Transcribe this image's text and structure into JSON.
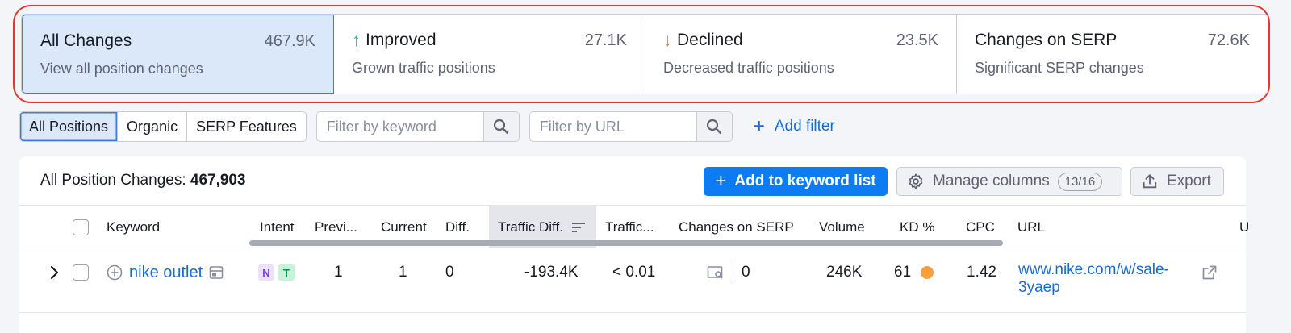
{
  "cards": [
    {
      "title": "All Changes",
      "count": "467.9K",
      "subtitle": "View all position changes",
      "arrow": ""
    },
    {
      "title": "Improved",
      "count": "27.1K",
      "subtitle": "Grown traffic positions",
      "arrow": "↑"
    },
    {
      "title": "Declined",
      "count": "23.5K",
      "subtitle": "Decreased traffic positions",
      "arrow": "↓"
    },
    {
      "title": "Changes on SERP",
      "count": "72.6K",
      "subtitle": "Significant SERP changes",
      "arrow": ""
    }
  ],
  "filters": {
    "segments": [
      "All Positions",
      "Organic",
      "SERP Features"
    ],
    "keyword_placeholder": "Filter by keyword",
    "url_placeholder": "Filter by URL",
    "add_filter": "Add filter"
  },
  "table": {
    "summary_label": "All Position Changes:",
    "summary_count": "467,903",
    "add_to_list": "Add to keyword list",
    "manage_columns": "Manage columns",
    "columns_count": "13/16",
    "export": "Export",
    "columns": [
      "Keyword",
      "Intent",
      "Previ...",
      "Current",
      "Diff.",
      "Traffic Diff.",
      "Traffic...",
      "Changes on SERP",
      "Volume",
      "KD %",
      "CPC",
      "URL",
      "U"
    ],
    "rows": [
      {
        "keyword": "nike outlet",
        "intent": [
          "N",
          "T"
        ],
        "previous": "1",
        "current": "1",
        "diff": "0",
        "traffic_diff": "-193.4K",
        "traffic": "< 0.01",
        "changes_on_serp": "0",
        "volume": "246K",
        "kd": "61",
        "cpc": "1.42",
        "url_line1": "www.nike.com/w/sale-",
        "url_line2": "3yaep"
      }
    ]
  },
  "colors": {
    "accent": "#0d7cf2",
    "improved": "#1ec18d",
    "declined": "#f28a1f",
    "kd_dot": "#f8a040",
    "highlight": "#e8352b"
  }
}
